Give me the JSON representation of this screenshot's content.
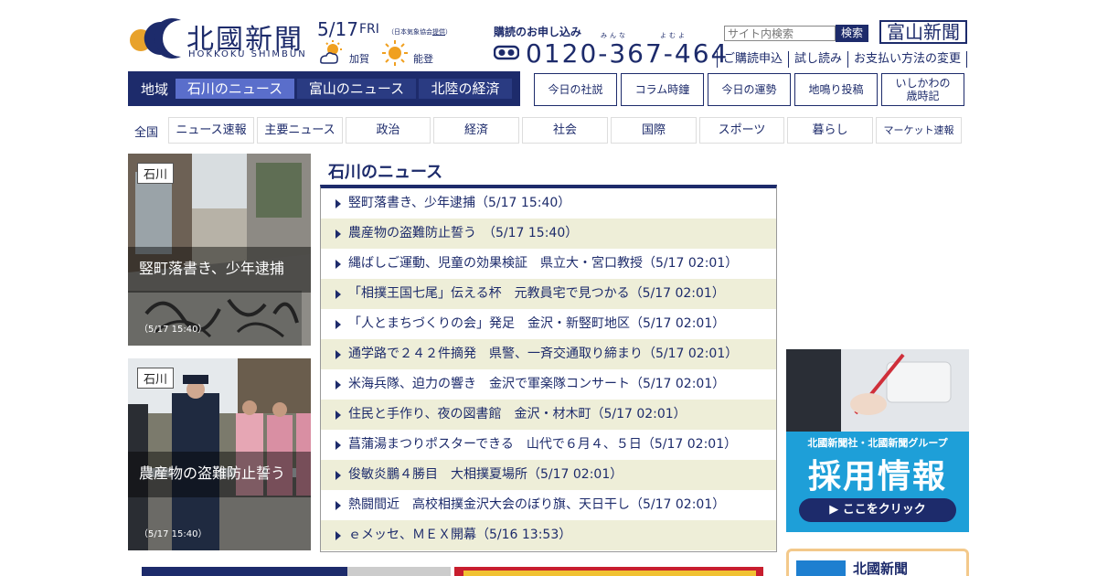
{
  "header": {
    "logo_text": "北國新聞",
    "logo_roman": "HOKKOKU SHIMBUN",
    "date": "5/17",
    "weekday": "FRI",
    "weather_source_prefix": "（日本気象協会",
    "weather_source_link": "提供",
    "weather_source_suffix": "）",
    "weather": [
      {
        "region": "加賀",
        "icon": "sun-cloud-icon"
      },
      {
        "region": "能登",
        "icon": "sun-icon"
      }
    ],
    "subscribe_title": "購読のお申し込み",
    "ruby_1": "みんな",
    "ruby_2": "よむよ",
    "phone": "0120-367-464",
    "search_placeholder": "サイト内検索",
    "search_button": "検索",
    "toyama_logo": "富山新聞",
    "top_links": [
      "ご購読申込",
      "試し読み",
      "お支払い方法の変更"
    ]
  },
  "region_nav": {
    "label": "地域",
    "tabs": [
      "石川のニュース",
      "富山のニュース",
      "北陸の経済"
    ],
    "active": "石川のニュース"
  },
  "corners": [
    "今日の社説",
    "コラム時鐘",
    "今日の運勢",
    "地鳴り投稿",
    "いしかわの\n歳時記"
  ],
  "category": {
    "label": "全国",
    "items": [
      "ニュース速報",
      "主要ニュース",
      "政治",
      "経済",
      "社会",
      "国際",
      "スポーツ",
      "暮らし",
      "マーケット速報"
    ]
  },
  "photos": [
    {
      "tag": "石川",
      "caption": "竪町落書き、少年逮捕",
      "time": "（5/17 15:40）"
    },
    {
      "tag": "石川",
      "caption": "農産物の盗難防止誓う",
      "time": "（5/17 15:40）"
    }
  ],
  "news": {
    "title": "石川のニュース",
    "items": [
      "竪町落書き、少年逮捕（5/17 15:40）",
      "農産物の盗難防止誓う　（5/17 15:40）",
      "縄ばしご運動、児童の効果検証　県立大・宮口教授（5/17 02:01）",
      "「相撲王国七尾」伝える杯　元教員宅で見つかる（5/17 02:01）",
      "「人とまちづくりの会」発足　金沢・新竪町地区（5/17 02:01）",
      "通学路で２４２件摘発　県警、一斉交通取り締まり（5/17 02:01）",
      "米海兵隊、迫力の響き　金沢で軍楽隊コンサート（5/17 02:01）",
      "住民と手作り、夜の図書館　金沢・材木町（5/17 02:01）",
      "菖蒲湯まつりポスターできる　山代で６月４、５日（5/17 02:01）",
      "俊敏炎鵬４勝目　大相撲夏場所（5/17 02:01）",
      "熱闘間近　高校相撲金沢大会のぼり旗、天日干し（5/17 02:01）",
      "ｅメッセ、ＭＥＸ開幕（5/16 13:53）"
    ]
  },
  "banner": {
    "line1": "北國新聞社・北國新聞グループ",
    "line2": "採用情報",
    "button": "▶ ここをクリック"
  },
  "subbox": {
    "text": "北國新聞"
  },
  "colors": {
    "brand": "#1d2b6b",
    "active_tab": "#5a6ecb",
    "stripe": "#eeeed8",
    "banner_blue": "#1e9fd8"
  }
}
